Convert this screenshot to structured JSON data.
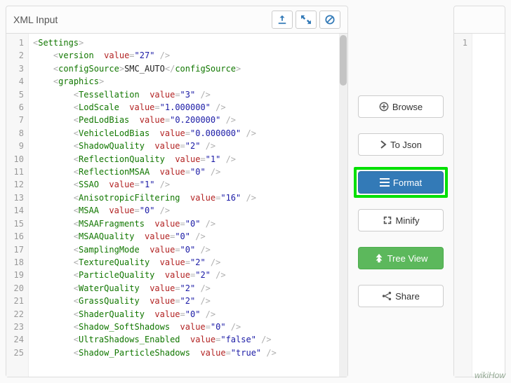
{
  "header": {
    "title": "XML Input"
  },
  "toolbar_icons": {
    "upload": "upload-icon",
    "expand": "expand-icon",
    "clear": "clear-icon"
  },
  "buttons": {
    "browse": "Browse",
    "tojson": "To Json",
    "format": "Format",
    "minify": "Minify",
    "treeview": "Tree View",
    "share": "Share"
  },
  "right_gutter": [
    "1"
  ],
  "code_lines": [
    {
      "n": 1,
      "indent": 0,
      "parts": [
        {
          "t": "dim",
          "v": "<"
        },
        {
          "t": "tag",
          "v": "Settings"
        },
        {
          "t": "dim",
          "v": ">"
        }
      ]
    },
    {
      "n": 2,
      "indent": 1,
      "parts": [
        {
          "t": "dim",
          "v": "<"
        },
        {
          "t": "tag",
          "v": "version"
        },
        {
          "t": "plain",
          "v": "  "
        },
        {
          "t": "attr",
          "v": "value"
        },
        {
          "t": "dim",
          "v": "="
        },
        {
          "t": "val",
          "v": "\"27\""
        },
        {
          "t": "dim",
          "v": " />"
        }
      ]
    },
    {
      "n": 3,
      "indent": 1,
      "parts": [
        {
          "t": "dim",
          "v": "<"
        },
        {
          "t": "tag",
          "v": "configSource"
        },
        {
          "t": "dim",
          "v": ">"
        },
        {
          "t": "txt",
          "v": "SMC_AUTO"
        },
        {
          "t": "dim",
          "v": "</"
        },
        {
          "t": "tag",
          "v": "configSource"
        },
        {
          "t": "dim",
          "v": ">"
        }
      ]
    },
    {
      "n": 4,
      "indent": 1,
      "parts": [
        {
          "t": "dim",
          "v": "<"
        },
        {
          "t": "tag",
          "v": "graphics"
        },
        {
          "t": "dim",
          "v": ">"
        }
      ]
    },
    {
      "n": 5,
      "indent": 2,
      "parts": [
        {
          "t": "dim",
          "v": "<"
        },
        {
          "t": "tag",
          "v": "Tessellation"
        },
        {
          "t": "plain",
          "v": "  "
        },
        {
          "t": "attr",
          "v": "value"
        },
        {
          "t": "dim",
          "v": "="
        },
        {
          "t": "val",
          "v": "\"3\""
        },
        {
          "t": "dim",
          "v": " />"
        }
      ]
    },
    {
      "n": 6,
      "indent": 2,
      "parts": [
        {
          "t": "dim",
          "v": "<"
        },
        {
          "t": "tag",
          "v": "LodScale"
        },
        {
          "t": "plain",
          "v": "  "
        },
        {
          "t": "attr",
          "v": "value"
        },
        {
          "t": "dim",
          "v": "="
        },
        {
          "t": "val",
          "v": "\"1.000000\""
        },
        {
          "t": "dim",
          "v": " />"
        }
      ]
    },
    {
      "n": 7,
      "indent": 2,
      "parts": [
        {
          "t": "dim",
          "v": "<"
        },
        {
          "t": "tag",
          "v": "PedLodBias"
        },
        {
          "t": "plain",
          "v": "  "
        },
        {
          "t": "attr",
          "v": "value"
        },
        {
          "t": "dim",
          "v": "="
        },
        {
          "t": "val",
          "v": "\"0.200000\""
        },
        {
          "t": "dim",
          "v": " />"
        }
      ]
    },
    {
      "n": 8,
      "indent": 2,
      "parts": [
        {
          "t": "dim",
          "v": "<"
        },
        {
          "t": "tag",
          "v": "VehicleLodBias"
        },
        {
          "t": "plain",
          "v": "  "
        },
        {
          "t": "attr",
          "v": "value"
        },
        {
          "t": "dim",
          "v": "="
        },
        {
          "t": "val",
          "v": "\"0.000000\""
        },
        {
          "t": "dim",
          "v": " />"
        }
      ]
    },
    {
      "n": 9,
      "indent": 2,
      "parts": [
        {
          "t": "dim",
          "v": "<"
        },
        {
          "t": "tag",
          "v": "ShadowQuality"
        },
        {
          "t": "plain",
          "v": "  "
        },
        {
          "t": "attr",
          "v": "value"
        },
        {
          "t": "dim",
          "v": "="
        },
        {
          "t": "val",
          "v": "\"2\""
        },
        {
          "t": "dim",
          "v": " />"
        }
      ]
    },
    {
      "n": 10,
      "indent": 2,
      "parts": [
        {
          "t": "dim",
          "v": "<"
        },
        {
          "t": "tag",
          "v": "ReflectionQuality"
        },
        {
          "t": "plain",
          "v": "  "
        },
        {
          "t": "attr",
          "v": "value"
        },
        {
          "t": "dim",
          "v": "="
        },
        {
          "t": "val",
          "v": "\"1\""
        },
        {
          "t": "dim",
          "v": " />"
        }
      ]
    },
    {
      "n": 11,
      "indent": 2,
      "parts": [
        {
          "t": "dim",
          "v": "<"
        },
        {
          "t": "tag",
          "v": "ReflectionMSAA"
        },
        {
          "t": "plain",
          "v": "  "
        },
        {
          "t": "attr",
          "v": "value"
        },
        {
          "t": "dim",
          "v": "="
        },
        {
          "t": "val",
          "v": "\"0\""
        },
        {
          "t": "dim",
          "v": " />"
        }
      ]
    },
    {
      "n": 12,
      "indent": 2,
      "parts": [
        {
          "t": "dim",
          "v": "<"
        },
        {
          "t": "tag",
          "v": "SSAO"
        },
        {
          "t": "plain",
          "v": "  "
        },
        {
          "t": "attr",
          "v": "value"
        },
        {
          "t": "dim",
          "v": "="
        },
        {
          "t": "val",
          "v": "\"1\""
        },
        {
          "t": "dim",
          "v": " />"
        }
      ]
    },
    {
      "n": 13,
      "indent": 2,
      "parts": [
        {
          "t": "dim",
          "v": "<"
        },
        {
          "t": "tag",
          "v": "AnisotropicFiltering"
        },
        {
          "t": "plain",
          "v": "  "
        },
        {
          "t": "attr",
          "v": "value"
        },
        {
          "t": "dim",
          "v": "="
        },
        {
          "t": "val",
          "v": "\"16\""
        },
        {
          "t": "dim",
          "v": " />"
        }
      ]
    },
    {
      "n": 14,
      "indent": 2,
      "parts": [
        {
          "t": "dim",
          "v": "<"
        },
        {
          "t": "tag",
          "v": "MSAA"
        },
        {
          "t": "plain",
          "v": "  "
        },
        {
          "t": "attr",
          "v": "value"
        },
        {
          "t": "dim",
          "v": "="
        },
        {
          "t": "val",
          "v": "\"0\""
        },
        {
          "t": "dim",
          "v": " />"
        }
      ]
    },
    {
      "n": 15,
      "indent": 2,
      "parts": [
        {
          "t": "dim",
          "v": "<"
        },
        {
          "t": "tag",
          "v": "MSAAFragments"
        },
        {
          "t": "plain",
          "v": "  "
        },
        {
          "t": "attr",
          "v": "value"
        },
        {
          "t": "dim",
          "v": "="
        },
        {
          "t": "val",
          "v": "\"0\""
        },
        {
          "t": "dim",
          "v": " />"
        }
      ]
    },
    {
      "n": 16,
      "indent": 2,
      "parts": [
        {
          "t": "dim",
          "v": "<"
        },
        {
          "t": "tag",
          "v": "MSAAQuality"
        },
        {
          "t": "plain",
          "v": "  "
        },
        {
          "t": "attr",
          "v": "value"
        },
        {
          "t": "dim",
          "v": "="
        },
        {
          "t": "val",
          "v": "\"0\""
        },
        {
          "t": "dim",
          "v": " />"
        }
      ]
    },
    {
      "n": 17,
      "indent": 2,
      "parts": [
        {
          "t": "dim",
          "v": "<"
        },
        {
          "t": "tag",
          "v": "SamplingMode"
        },
        {
          "t": "plain",
          "v": "  "
        },
        {
          "t": "attr",
          "v": "value"
        },
        {
          "t": "dim",
          "v": "="
        },
        {
          "t": "val",
          "v": "\"0\""
        },
        {
          "t": "dim",
          "v": " />"
        }
      ]
    },
    {
      "n": 18,
      "indent": 2,
      "parts": [
        {
          "t": "dim",
          "v": "<"
        },
        {
          "t": "tag",
          "v": "TextureQuality"
        },
        {
          "t": "plain",
          "v": "  "
        },
        {
          "t": "attr",
          "v": "value"
        },
        {
          "t": "dim",
          "v": "="
        },
        {
          "t": "val",
          "v": "\"2\""
        },
        {
          "t": "dim",
          "v": " />"
        }
      ]
    },
    {
      "n": 19,
      "indent": 2,
      "parts": [
        {
          "t": "dim",
          "v": "<"
        },
        {
          "t": "tag",
          "v": "ParticleQuality"
        },
        {
          "t": "plain",
          "v": "  "
        },
        {
          "t": "attr",
          "v": "value"
        },
        {
          "t": "dim",
          "v": "="
        },
        {
          "t": "val",
          "v": "\"2\""
        },
        {
          "t": "dim",
          "v": " />"
        }
      ]
    },
    {
      "n": 20,
      "indent": 2,
      "parts": [
        {
          "t": "dim",
          "v": "<"
        },
        {
          "t": "tag",
          "v": "WaterQuality"
        },
        {
          "t": "plain",
          "v": "  "
        },
        {
          "t": "attr",
          "v": "value"
        },
        {
          "t": "dim",
          "v": "="
        },
        {
          "t": "val",
          "v": "\"2\""
        },
        {
          "t": "dim",
          "v": " />"
        }
      ]
    },
    {
      "n": 21,
      "indent": 2,
      "parts": [
        {
          "t": "dim",
          "v": "<"
        },
        {
          "t": "tag",
          "v": "GrassQuality"
        },
        {
          "t": "plain",
          "v": "  "
        },
        {
          "t": "attr",
          "v": "value"
        },
        {
          "t": "dim",
          "v": "="
        },
        {
          "t": "val",
          "v": "\"2\""
        },
        {
          "t": "dim",
          "v": " />"
        }
      ]
    },
    {
      "n": 22,
      "indent": 2,
      "parts": [
        {
          "t": "dim",
          "v": "<"
        },
        {
          "t": "tag",
          "v": "ShaderQuality"
        },
        {
          "t": "plain",
          "v": "  "
        },
        {
          "t": "attr",
          "v": "value"
        },
        {
          "t": "dim",
          "v": "="
        },
        {
          "t": "val",
          "v": "\"0\""
        },
        {
          "t": "dim",
          "v": " />"
        }
      ]
    },
    {
      "n": 23,
      "indent": 2,
      "parts": [
        {
          "t": "dim",
          "v": "<"
        },
        {
          "t": "tag",
          "v": "Shadow_SoftShadows"
        },
        {
          "t": "plain",
          "v": "  "
        },
        {
          "t": "attr",
          "v": "value"
        },
        {
          "t": "dim",
          "v": "="
        },
        {
          "t": "val",
          "v": "\"0\""
        },
        {
          "t": "dim",
          "v": " />"
        }
      ]
    },
    {
      "n": 24,
      "indent": 2,
      "parts": [
        {
          "t": "dim",
          "v": "<"
        },
        {
          "t": "tag",
          "v": "UltraShadows_Enabled"
        },
        {
          "t": "plain",
          "v": "  "
        },
        {
          "t": "attr",
          "v": "value"
        },
        {
          "t": "dim",
          "v": "="
        },
        {
          "t": "val",
          "v": "\"false\""
        },
        {
          "t": "dim",
          "v": " />"
        }
      ]
    },
    {
      "n": 25,
      "indent": 2,
      "parts": [
        {
          "t": "dim",
          "v": "<"
        },
        {
          "t": "tag",
          "v": "Shadow_ParticleShadows"
        },
        {
          "t": "plain",
          "v": "  "
        },
        {
          "t": "attr",
          "v": "value"
        },
        {
          "t": "dim",
          "v": "="
        },
        {
          "t": "val",
          "v": "\"true\""
        },
        {
          "t": "dim",
          "v": " />"
        }
      ]
    }
  ],
  "watermark": "wikiHow"
}
